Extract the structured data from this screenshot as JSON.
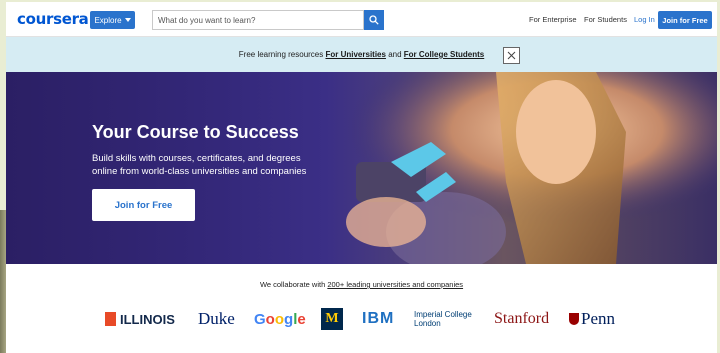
{
  "header": {
    "logo": "coursera",
    "explore_label": "Explore",
    "search_placeholder": "What do you want to learn?",
    "nav": {
      "enterprise": "For Enterprise",
      "students": "For Students",
      "login": "Log In",
      "join": "Join for Free"
    }
  },
  "banner": {
    "prefix": "Free learning resources",
    "link1": "For Universities",
    "middle": "and",
    "link2": "For College Students"
  },
  "hero": {
    "title": "Your Course to Success",
    "subtitle_line1": "Build skills with courses, certificates, and degrees",
    "subtitle_line2": "online from world-class universities and companies",
    "cta": "Join for Free"
  },
  "partners": {
    "prefix": "We collaborate with",
    "link": "200+ leading universities and companies",
    "logos": {
      "illinois": "ILLINOIS",
      "duke": "Duke",
      "google": "Google",
      "michigan": "M",
      "ibm": "IBM",
      "imperial_line1": "Imperial College",
      "imperial_line2": "London",
      "stanford": "Stanford",
      "penn": "Penn"
    }
  },
  "colors": {
    "brand": "#0056d2",
    "button": "#2a73cc",
    "banner_bg": "#d6ecf3",
    "hero_bg": "#2b1f64"
  },
  "icons": [
    "chevron-down-icon",
    "search-icon",
    "close-icon"
  ]
}
